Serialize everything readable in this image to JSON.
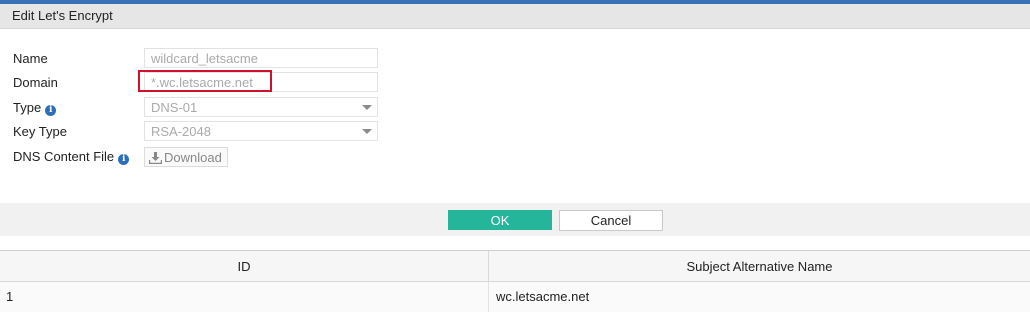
{
  "dialog": {
    "title": "Edit Let's Encrypt"
  },
  "form": {
    "name": {
      "label": "Name",
      "value": "wildcard_letsacme"
    },
    "domain": {
      "label": "Domain",
      "value": "*.wc.letsacme.net"
    },
    "type": {
      "label": "Type",
      "value": "DNS-01",
      "info_icon": "info-icon"
    },
    "key_type": {
      "label": "Key Type",
      "value": "RSA-2048"
    },
    "dns_content_file": {
      "label": "DNS Content File",
      "button_label": "Download",
      "info_icon": "info-icon"
    }
  },
  "buttons": {
    "ok_label": "OK",
    "cancel_label": "Cancel"
  },
  "table": {
    "columns": [
      "ID",
      "Subject Alternative Name"
    ],
    "rows": [
      {
        "id": "1",
        "san": "wc.letsacme.net"
      }
    ]
  },
  "colors": {
    "accent": "#3a72b8",
    "ok_button": "#25b59a",
    "highlight": "#d0112b",
    "info_icon": "#2c6fb8"
  }
}
